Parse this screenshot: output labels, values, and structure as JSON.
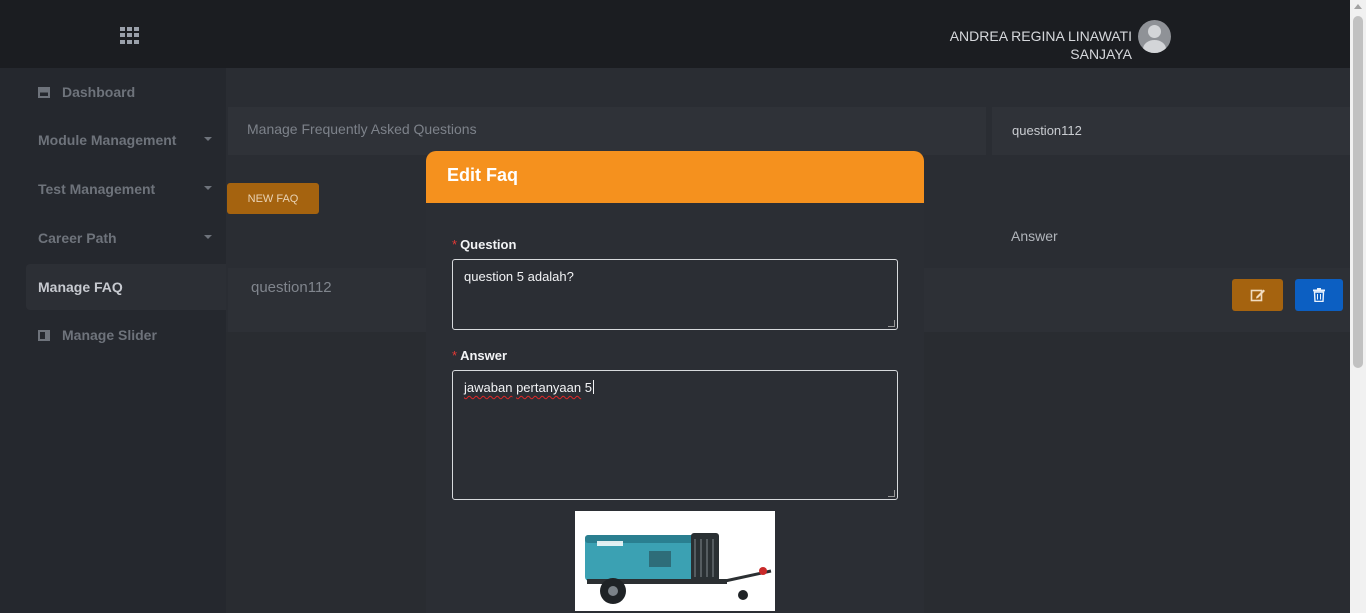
{
  "header": {
    "user_name_line1": "ANDREA REGINA LINAWATI",
    "user_name_line2": "SANJAYA"
  },
  "sidebar": {
    "items": [
      {
        "label": "Dashboard"
      },
      {
        "label": "Module Management"
      },
      {
        "label": "Test Management"
      },
      {
        "label": "Career Path"
      },
      {
        "label": "Manage FAQ"
      },
      {
        "label": "Manage Slider"
      }
    ],
    "active": "Manage FAQ"
  },
  "main": {
    "page_title": "Manage Frequently Asked Questions",
    "search_value": "question112",
    "new_button_label": "NEW FAQ",
    "column_answer": "Answer",
    "rows": [
      {
        "question": "question112"
      }
    ]
  },
  "modal": {
    "title": "Edit Faq",
    "question_label": "Question",
    "question_value": "question 5 adalah?",
    "answer_label": "Answer",
    "answer_value_part1": "jawaban",
    "answer_value_part2": "pertanyaan",
    "answer_value_part3": "5",
    "required_mark": "*"
  },
  "colors": {
    "modal_header": "#f5911e",
    "edit_button": "#a5630f",
    "delete_button": "#0c5fc2"
  }
}
